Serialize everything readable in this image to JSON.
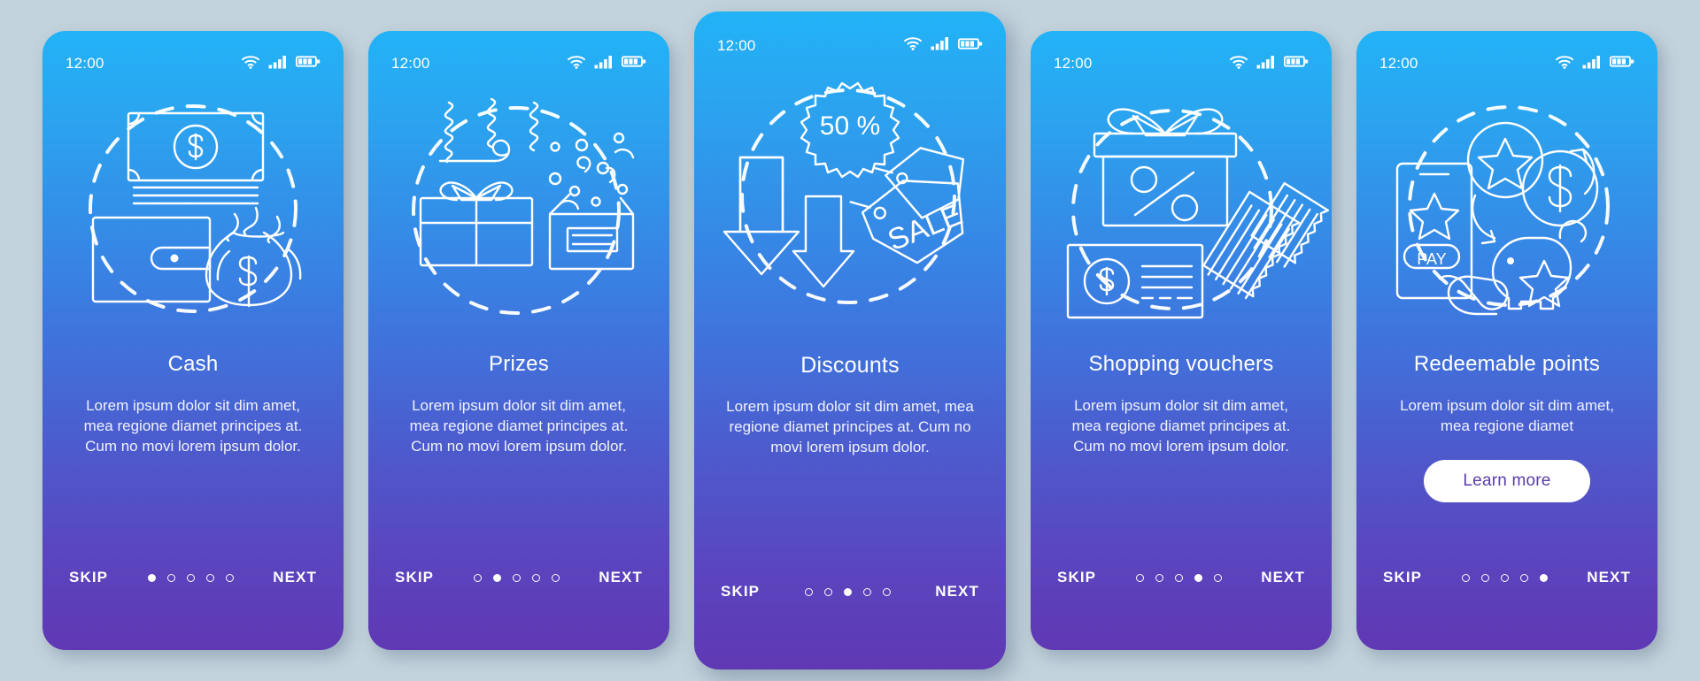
{
  "background_color": "#c3d3dc",
  "card_gradient": {
    "top": "#22b3f7",
    "bottom": "#6038b4"
  },
  "status_bar": {
    "time": "12:00",
    "icons": [
      "wifi-icon",
      "cellular-signal-icon",
      "battery-icon"
    ]
  },
  "common": {
    "skip_label": "SKIP",
    "next_label": "NEXT",
    "dot_count": 5
  },
  "screens": [
    {
      "id": "cash",
      "title": "Cash",
      "description": "Lorem ipsum dolor sit dim amet, mea regione diamet principes at. Cum no movi lorem ipsum dolor.",
      "illustration": "cash-illustration",
      "illustration_parts": [
        "banknote-icon",
        "dollar-coin-icon",
        "wallet-icon",
        "money-bag-icon",
        "dashed-circle"
      ],
      "active_dot": 1,
      "skip_label": "SKIP",
      "next_label": "NEXT",
      "featured": false,
      "cta_label": null
    },
    {
      "id": "prizes",
      "title": "Prizes",
      "description": "Lorem ipsum dolor sit dim amet, mea regione diamet principes at. Cum no movi lorem ipsum dolor.",
      "illustration": "prizes-illustration",
      "illustration_parts": [
        "streamer-icon",
        "party-blower-icon",
        "gift-box-icon",
        "confetti-box-icon",
        "dashed-circle"
      ],
      "active_dot": 2,
      "skip_label": "SKIP",
      "next_label": "NEXT",
      "featured": false,
      "cta_label": null
    },
    {
      "id": "discounts",
      "title": "Discounts",
      "description": "Lorem ipsum dolor sit dim amet, mea regione diamet principes at. Cum no movi lorem ipsum dolor.",
      "illustration": "discounts-illustration",
      "illustration_parts": [
        "starburst-badge-icon",
        "down-arrow-icon",
        "sale-tag-icon",
        "dashed-circle"
      ],
      "badge_text": "50 %",
      "tag_text": "SALE",
      "active_dot": 3,
      "skip_label": "SKIP",
      "next_label": "NEXT",
      "featured": true,
      "cta_label": null
    },
    {
      "id": "shopping-vouchers",
      "title": "Shopping vouchers",
      "description": "Lorem ipsum dolor sit dim amet, mea regione diamet principes at. Cum no movi lorem ipsum dolor.",
      "illustration": "shopping-vouchers-illustration",
      "illustration_parts": [
        "gift-box-percent-icon",
        "voucher-card-icon",
        "ticket-icon",
        "dashed-circle"
      ],
      "badge_text": "%",
      "active_dot": 4,
      "skip_label": "SKIP",
      "next_label": "NEXT",
      "featured": false,
      "cta_label": null
    },
    {
      "id": "redeemable-points",
      "title": "Redeemable points",
      "description": "Lorem ipsum dolor sit dim amet, mea regione diamet",
      "illustration": "redeemable-points-illustration",
      "illustration_parts": [
        "smartphone-pay-icon",
        "star-coin-icon",
        "dollar-coin-icon",
        "piggy-bank-icon",
        "exchange-arrows-icon",
        "hand-pointer-icon",
        "dashed-circle"
      ],
      "badge_text": "PAY",
      "active_dot": 5,
      "skip_label": "SKIP",
      "next_label": "NEXT",
      "featured": false,
      "cta_label": "Learn more"
    }
  ]
}
